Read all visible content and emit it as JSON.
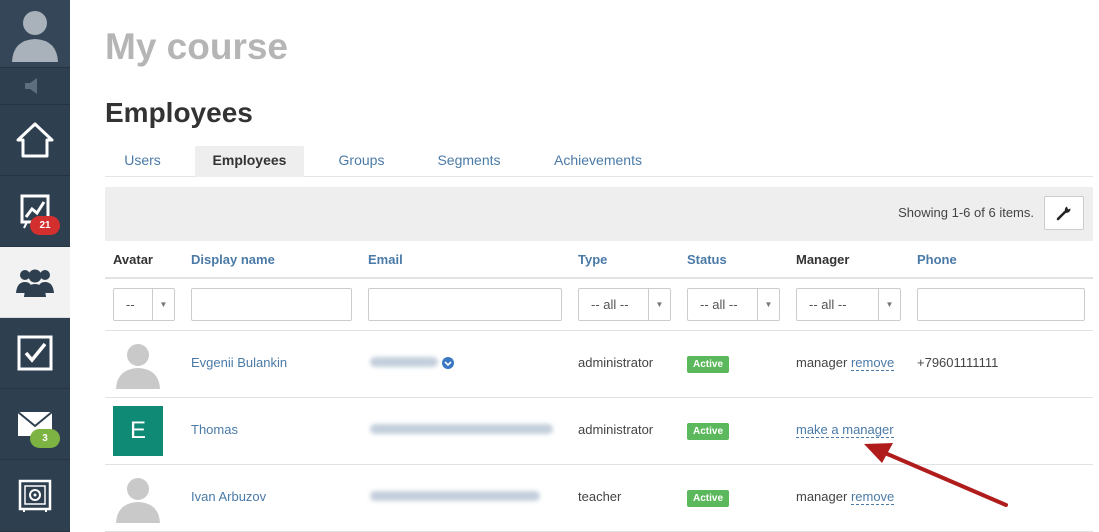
{
  "sidebar": {
    "stats_badge": "21",
    "mail_badge": "3"
  },
  "page": {
    "course_title": "My course",
    "title": "Employees"
  },
  "tabs": [
    "Users",
    "Employees",
    "Groups",
    "Segments",
    "Achievements"
  ],
  "active_tab": "Employees",
  "toolbar": {
    "summary": "Showing 1-6 of 6 items."
  },
  "table": {
    "columns": [
      "Avatar",
      "Display name",
      "Email",
      "Type",
      "Status",
      "Manager",
      "Phone"
    ],
    "filters": {
      "avatar": "--",
      "type": "-- all --",
      "status": "-- all --",
      "manager": "-- all --"
    },
    "rows": [
      {
        "avatar": "",
        "name": "Evgenii Bulankin",
        "type": "administrator",
        "status": "Active",
        "manager_text": "manager",
        "manager_action": "remove",
        "phone": "+79601111111"
      },
      {
        "avatar": "E",
        "name": "Thomas",
        "type": "administrator",
        "status": "Active",
        "manager_text": "",
        "manager_action": "make a manager",
        "phone": ""
      },
      {
        "avatar": "",
        "name": "Ivan Arbuzov",
        "type": "teacher",
        "status": "Active",
        "manager_text": "manager",
        "manager_action": "remove",
        "phone": ""
      }
    ]
  },
  "colors": {
    "sidebar_bg": "#2e3f50",
    "link": "#4a7aa7",
    "active_badge": "#5cb85c",
    "avatar_letter_bg": "#0f8a74",
    "annotation_arrow": "#b01c1c"
  }
}
